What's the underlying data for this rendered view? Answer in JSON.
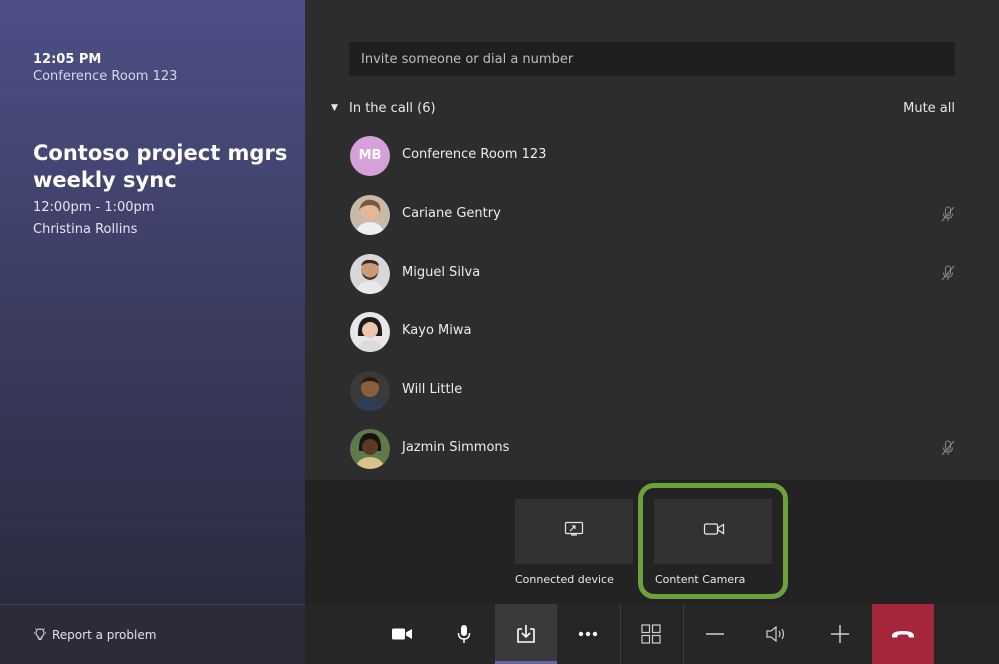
{
  "meeting": {
    "time": "12:05 PM",
    "room": "Conference Room 123",
    "title": "Contoso project mgrs weekly sync",
    "time_range": "12:00pm - 1:00pm",
    "organizer": "Christina Rollins"
  },
  "invite": {
    "placeholder": "Invite someone or dial a number"
  },
  "call": {
    "section_label": "In the call (6)",
    "mute_all_label": "Mute all",
    "participants": [
      {
        "name": "Conference Room 123",
        "initials": "MB",
        "muted": false,
        "avatar_color": "#d6a1d8"
      },
      {
        "name": "Cariane Gentry",
        "muted": true,
        "avatar_color": "#b98a6a"
      },
      {
        "name": "Miguel Silva",
        "muted": true,
        "avatar_color": "#8a6b55"
      },
      {
        "name": "Kayo Miwa",
        "muted": false,
        "avatar_color": "#d9b39a"
      },
      {
        "name": "Will Little",
        "muted": false,
        "avatar_color": "#7a5233"
      },
      {
        "name": "Jazmin Simmons",
        "muted": true,
        "avatar_color": "#4a3222"
      }
    ]
  },
  "share": {
    "connected_device_label": "Connected device",
    "content_camera_label": "Content Camera",
    "highlight_color": "#6ca23b"
  },
  "footer": {
    "report_label": "Report a problem"
  },
  "toolbar": {
    "buttons": [
      "camera-icon",
      "microphone-icon",
      "share-tray-icon",
      "more-icon",
      "layout-grid-icon",
      "volume-down-icon",
      "speaker-icon",
      "volume-up-icon",
      "hang-up-icon"
    ],
    "active": "share-tray-icon",
    "hangup_color": "#a4263b",
    "accent_color": "#6264a7"
  }
}
